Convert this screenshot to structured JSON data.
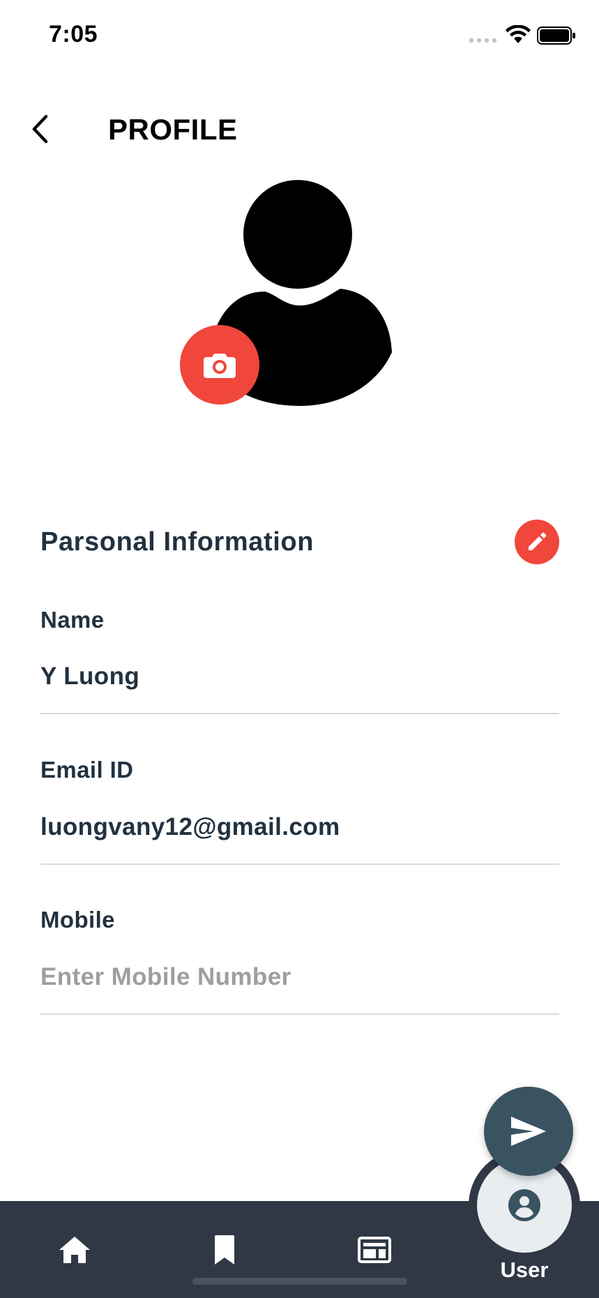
{
  "status_bar": {
    "time": "7:05"
  },
  "header": {
    "title": "PROFILE"
  },
  "section": {
    "title": "Parsonal Information"
  },
  "fields": {
    "name": {
      "label": "Name",
      "value": "Y Luong",
      "placeholder": ""
    },
    "email": {
      "label": "Email ID",
      "value": "luongvany12@gmail.com",
      "placeholder": ""
    },
    "mobile": {
      "label": "Mobile",
      "value": "",
      "placeholder": "Enter Mobile Number"
    }
  },
  "bottom_nav": {
    "items": [
      {
        "icon": "home-icon"
      },
      {
        "icon": "bookmark-icon"
      },
      {
        "icon": "news-icon"
      },
      {
        "icon": "user-icon",
        "label": "User",
        "active": true
      }
    ]
  },
  "icons": {
    "back": "back-arrow-icon",
    "camera": "camera-icon",
    "edit": "pencil-icon",
    "send": "send-icon"
  },
  "colors": {
    "accent": "#f0463c",
    "fab": "#3a5361",
    "nav_background": "#303845",
    "text": "#22313f",
    "placeholder": "#9e9e9e"
  }
}
